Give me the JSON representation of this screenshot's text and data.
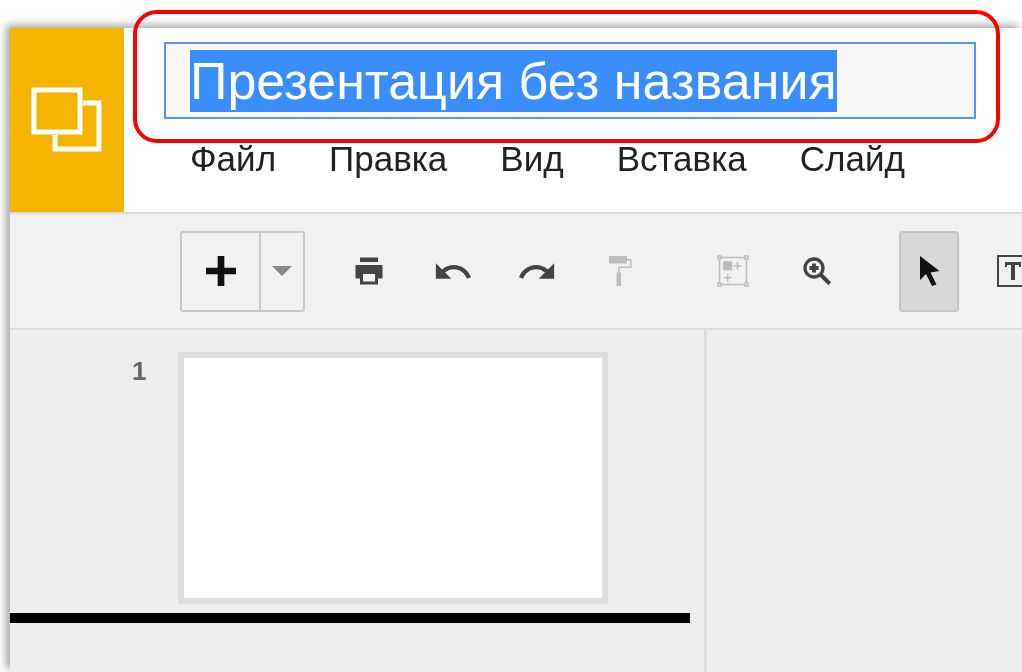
{
  "title_field": {
    "value": "Презентация без названия",
    "selected": true
  },
  "menu": [
    {
      "label": "Файл"
    },
    {
      "label": "Правка"
    },
    {
      "label": "Вид"
    },
    {
      "label": "Вставка"
    },
    {
      "label": "Слайд"
    }
  ],
  "toolbar": [
    {
      "kind": "new-slide",
      "disabled": false,
      "selected": false
    },
    {
      "kind": "print",
      "disabled": false,
      "selected": false
    },
    {
      "kind": "undo",
      "disabled": false,
      "selected": false
    },
    {
      "kind": "redo",
      "disabled": false,
      "selected": false
    },
    {
      "kind": "paint-format",
      "disabled": true,
      "selected": false
    },
    {
      "kind": "separator"
    },
    {
      "kind": "layout",
      "disabled": true,
      "selected": false
    },
    {
      "kind": "zoom",
      "disabled": false,
      "selected": false
    },
    {
      "kind": "separator"
    },
    {
      "kind": "select",
      "disabled": false,
      "selected": true
    },
    {
      "kind": "text-box",
      "disabled": false,
      "selected": false
    }
  ],
  "slides": [
    {
      "number": "1"
    }
  ]
}
